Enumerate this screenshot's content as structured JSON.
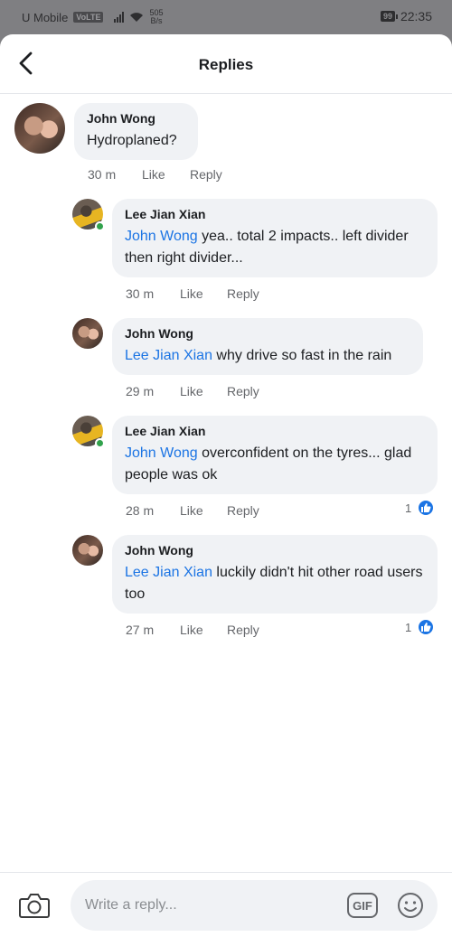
{
  "status_bar": {
    "carrier": "U Mobile",
    "volte": "VoLTE",
    "speed_value": "505",
    "speed_unit": "B/s",
    "battery": "99",
    "time": "22:35"
  },
  "header": {
    "title": "Replies"
  },
  "comments": [
    {
      "author": "John Wong",
      "mention": "",
      "text": "Hydroplaned?",
      "time": "30 m",
      "like": "Like",
      "reply": "Reply",
      "reaction_count": ""
    },
    {
      "author": "Lee Jian Xian",
      "mention": "John Wong",
      "text": " yea.. total 2 impacts.. left divider then right divider...",
      "time": "30 m",
      "like": "Like",
      "reply": "Reply",
      "reaction_count": ""
    },
    {
      "author": "John Wong",
      "mention": "Lee Jian Xian",
      "text": " why drive so fast in the rain",
      "time": "29 m",
      "like": "Like",
      "reply": "Reply",
      "reaction_count": ""
    },
    {
      "author": "Lee Jian Xian",
      "mention": "John Wong",
      "text": " overconfident on the tyres... glad people was ok",
      "time": "28 m",
      "like": "Like",
      "reply": "Reply",
      "reaction_count": "1"
    },
    {
      "author": "John Wong",
      "mention": "Lee Jian Xian",
      "text": " luckily didn't hit other road users too",
      "time": "27 m",
      "like": "Like",
      "reply": "Reply",
      "reaction_count": "1"
    }
  ],
  "composer": {
    "placeholder": "Write a reply...",
    "gif_label": "GIF"
  },
  "colors": {
    "mention": "#1b74e4",
    "bubble": "#f0f2f5",
    "online": "#31a24c"
  }
}
